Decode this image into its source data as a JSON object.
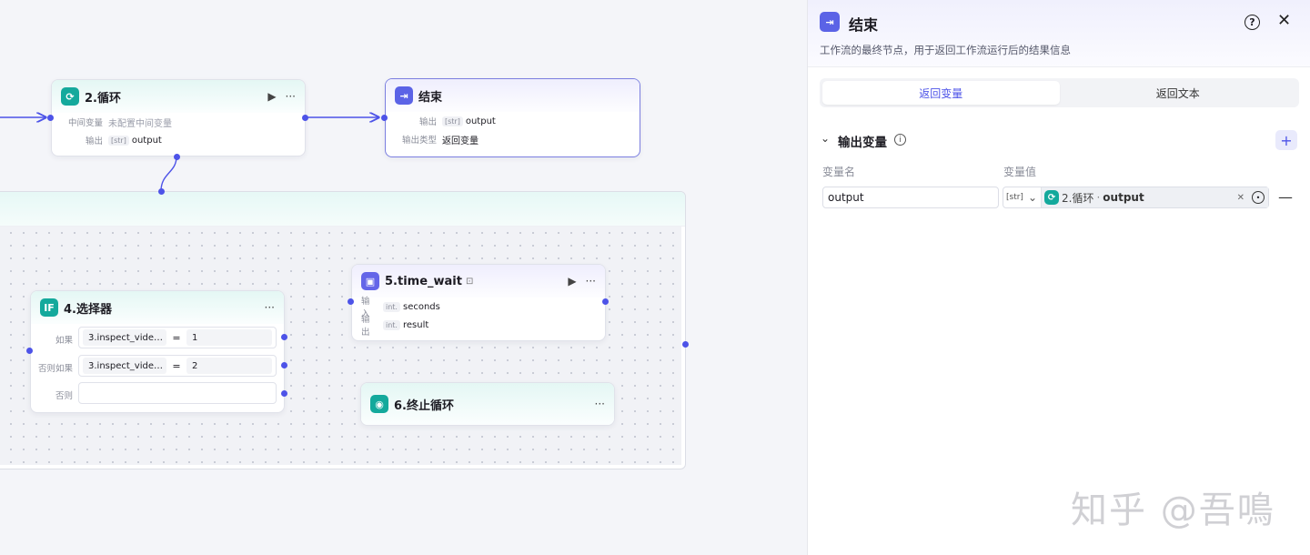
{
  "nodes": {
    "loop": {
      "title": "2.循环",
      "icon": "loop-icon",
      "rows": [
        {
          "label": "中间变量",
          "value": "未配置中间变量"
        },
        {
          "label": "输出",
          "type": "[str]",
          "value": "output"
        }
      ]
    },
    "end": {
      "title": "结束",
      "icon": "exit-icon",
      "rows": [
        {
          "label": "输出",
          "type": "[str]",
          "value": "output"
        },
        {
          "label": "输出类型",
          "value": "返回变量"
        }
      ]
    },
    "selector": {
      "title": "4.选择器",
      "icon_text": "IF",
      "conditions": [
        {
          "label": "如果",
          "left": "3.inspect_vide…",
          "op": "=",
          "right": "1"
        },
        {
          "label": "否则如果",
          "left": "3.inspect_vide…",
          "op": "=",
          "right": "2"
        },
        {
          "label": "否则",
          "left": "",
          "op": "",
          "right": ""
        }
      ]
    },
    "time_wait": {
      "title": "5.time_wait",
      "icon": "plugin-cube-icon",
      "rows": [
        {
          "label": "输入",
          "type": "int.",
          "value": "seconds"
        },
        {
          "label": "输出",
          "type": "int.",
          "value": "result"
        }
      ]
    },
    "break_loop": {
      "title": "6.终止循环",
      "icon": "stop-circle-icon"
    }
  },
  "panel": {
    "title": "结束",
    "description": "工作流的最终节点，用于返回工作流运行后的结果信息",
    "tabs": [
      {
        "label": "返回变量",
        "active": true
      },
      {
        "label": "返回文本",
        "active": false
      }
    ],
    "section_title": "输出变量",
    "col_name": "变量名",
    "col_value": "变量值",
    "variable": {
      "name": "output",
      "type": "[str]",
      "ref_node": "2.循环",
      "ref_sep": "·",
      "ref_field": "output"
    }
  },
  "watermark": "知乎 @吾鳴",
  "colors": {
    "accent": "#4d53e8",
    "teal": "#14a99c",
    "purple": "#5b63e6"
  }
}
